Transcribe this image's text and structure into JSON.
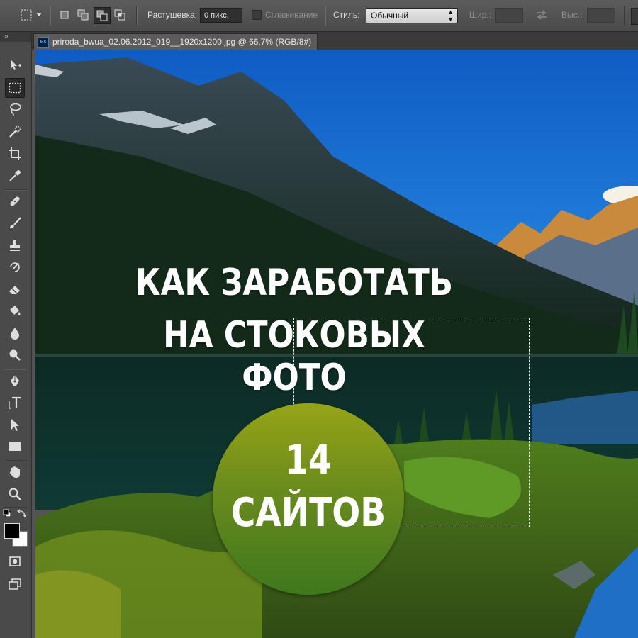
{
  "options_bar": {
    "feather_label": "Растушевка:",
    "feather_value": "0 пикс.",
    "antialias_label": "Сглаживание",
    "style_label": "Стиль:",
    "style_value": "Обычный",
    "width_label": "Шир.:",
    "height_label": "Выс.:"
  },
  "document": {
    "tab_title": "priroda_bwua_02.06.2012_019__1920x1200.jpg @ 66,7% (RGB/8#)",
    "app_badge": "Ps"
  },
  "artwork": {
    "headline_line1": "КАК ЗАРАБОТАТЬ",
    "headline_line2": "НА СТОКОВЫХ ФОТО",
    "badge_number": "14",
    "badge_word": "САЙТОВ"
  },
  "colors": {
    "sky": "#1a6fd6",
    "badge_top": "#97a416",
    "badge_bottom": "#3e781d"
  },
  "icons": {
    "tools": [
      "move-icon",
      "marquee-icon",
      "lasso-icon",
      "quick-select-icon",
      "crop-icon",
      "eyedropper-icon",
      "healing-icon",
      "brush-icon",
      "stamp-icon",
      "history-brush-icon",
      "eraser-icon",
      "paint-bucket-icon",
      "blur-icon",
      "dodge-icon",
      "pen-icon",
      "type-icon",
      "path-select-icon",
      "rectangle-icon",
      "hand-icon",
      "zoom-icon"
    ]
  }
}
